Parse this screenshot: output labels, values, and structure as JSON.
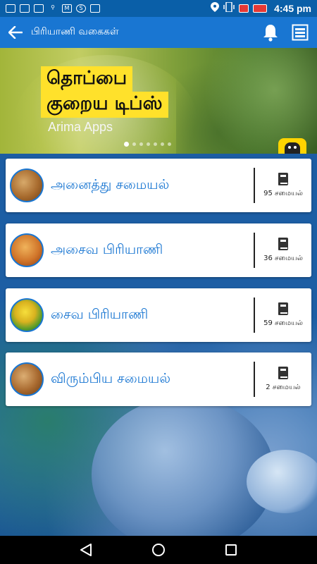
{
  "status_bar": {
    "time": "4:45 pm",
    "left_icons": [
      "app-icon",
      "mail-icon",
      "image-icon",
      "usb-icon",
      "gmail-icon",
      "skype-icon",
      "square-icon"
    ],
    "right_icons": [
      "location-icon",
      "vibrate-icon",
      "sim-icon",
      "battery-icon"
    ]
  },
  "app_bar": {
    "title": "பிரியாணி வகைகள்",
    "back_icon": "arrow-back-icon",
    "actions": [
      "bell-icon",
      "menu-list-icon"
    ]
  },
  "banner": {
    "line1": "தொப்பை",
    "line2": "குறைய டிப்ஸ்",
    "brand": "Arima Apps",
    "page_count": 7,
    "active_page": 1
  },
  "categories": [
    {
      "label": "அனைத்து சமையல்",
      "count": "95 சமையல்"
    },
    {
      "label": "அசைவ பிரியாணி",
      "count": "36 சமையல்"
    },
    {
      "label": "சைவ பிரியாணி",
      "count": "59 சமையல்"
    },
    {
      "label": "விரும்பிய சமையல்",
      "count": "2 சமையல்"
    }
  ],
  "nav_bar": {
    "items": [
      "back-triangle-icon",
      "home-circle-icon",
      "recents-square-icon"
    ]
  },
  "colors": {
    "status_bar": "#0a5fa8",
    "app_bar": "#1976d2",
    "label": "#1976d2",
    "banner_highlight": "#ffe12b"
  }
}
